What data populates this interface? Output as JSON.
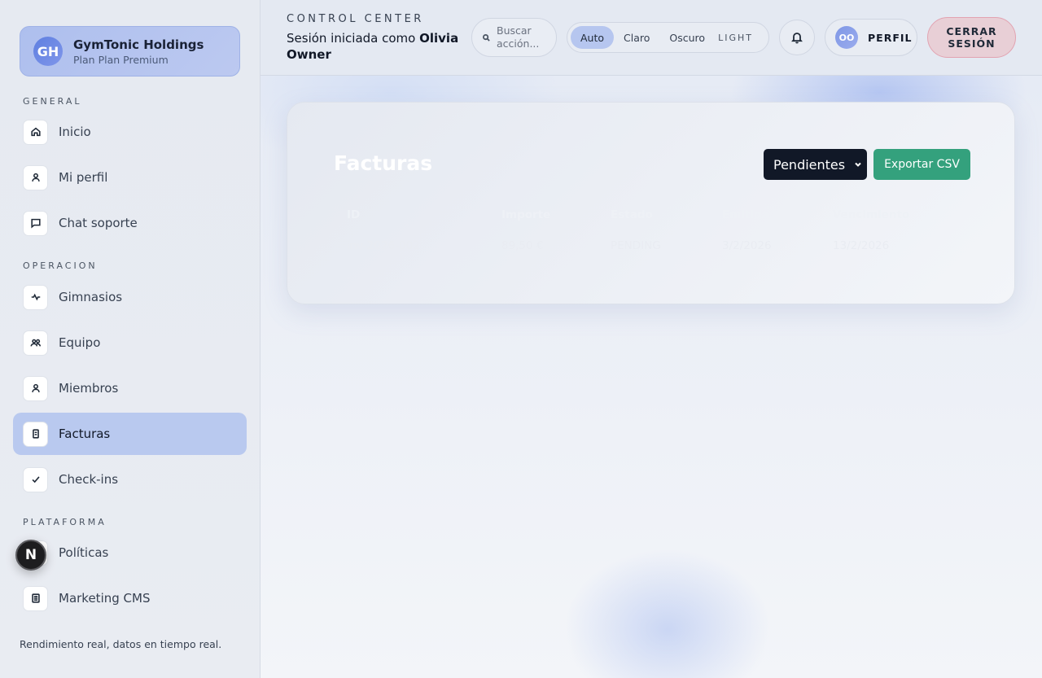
{
  "org": {
    "initials": "GH",
    "name": "GymTonic Holdings",
    "plan": "Plan Plan Premium"
  },
  "sidebar": {
    "sections": {
      "general": "GENERAL",
      "operacion": "OPERACION",
      "plataforma": "PLATAFORMA"
    },
    "items": [
      {
        "label": "Inicio",
        "icon": "home-icon"
      },
      {
        "label": "Mi perfil",
        "icon": "user-icon"
      },
      {
        "label": "Chat soporte",
        "icon": "chat-icon"
      },
      {
        "label": "Gimnasios",
        "icon": "activity-icon"
      },
      {
        "label": "Equipo",
        "icon": "users-icon"
      },
      {
        "label": "Miembros",
        "icon": "user-icon"
      },
      {
        "label": "Facturas",
        "icon": "receipt-icon",
        "active": true
      },
      {
        "label": "Check-ins",
        "icon": "check-icon"
      },
      {
        "label": "Políticas",
        "icon": "shield-icon"
      },
      {
        "label": "Marketing CMS",
        "icon": "document-icon"
      }
    ],
    "footer": "Rendimiento real, datos en tiempo real.",
    "badge": "N"
  },
  "topbar": {
    "eyebrow": "CONTROL CENTER",
    "session_prefix": "Sesión iniciada como ",
    "session_user": "Olivia Owner",
    "search_placeholder": "Buscar acción...",
    "theme": {
      "options": [
        "Auto",
        "Claro",
        "Oscuro"
      ],
      "selected": "Auto",
      "mode": "LIGHT"
    },
    "profile_initials": "OO",
    "profile_label": "PERFIL",
    "logout_label": "CERRAR SESIÓN"
  },
  "main": {
    "title": "Facturas",
    "filter": "Pendientes",
    "export_label": "Exportar CSV",
    "table": {
      "headers": [
        "ID",
        "Importe",
        "Estado",
        "Emitida",
        "Vencimiento"
      ],
      "rows": [
        [
          "inv-2026-002",
          "89,50 €",
          "PENDING",
          "3/2/2026",
          "13/2/2026"
        ]
      ]
    }
  },
  "colors": {
    "accent": "#b9c9ef",
    "export": "#34a17d",
    "logout": "#e8cfd6",
    "select": "#111827"
  }
}
